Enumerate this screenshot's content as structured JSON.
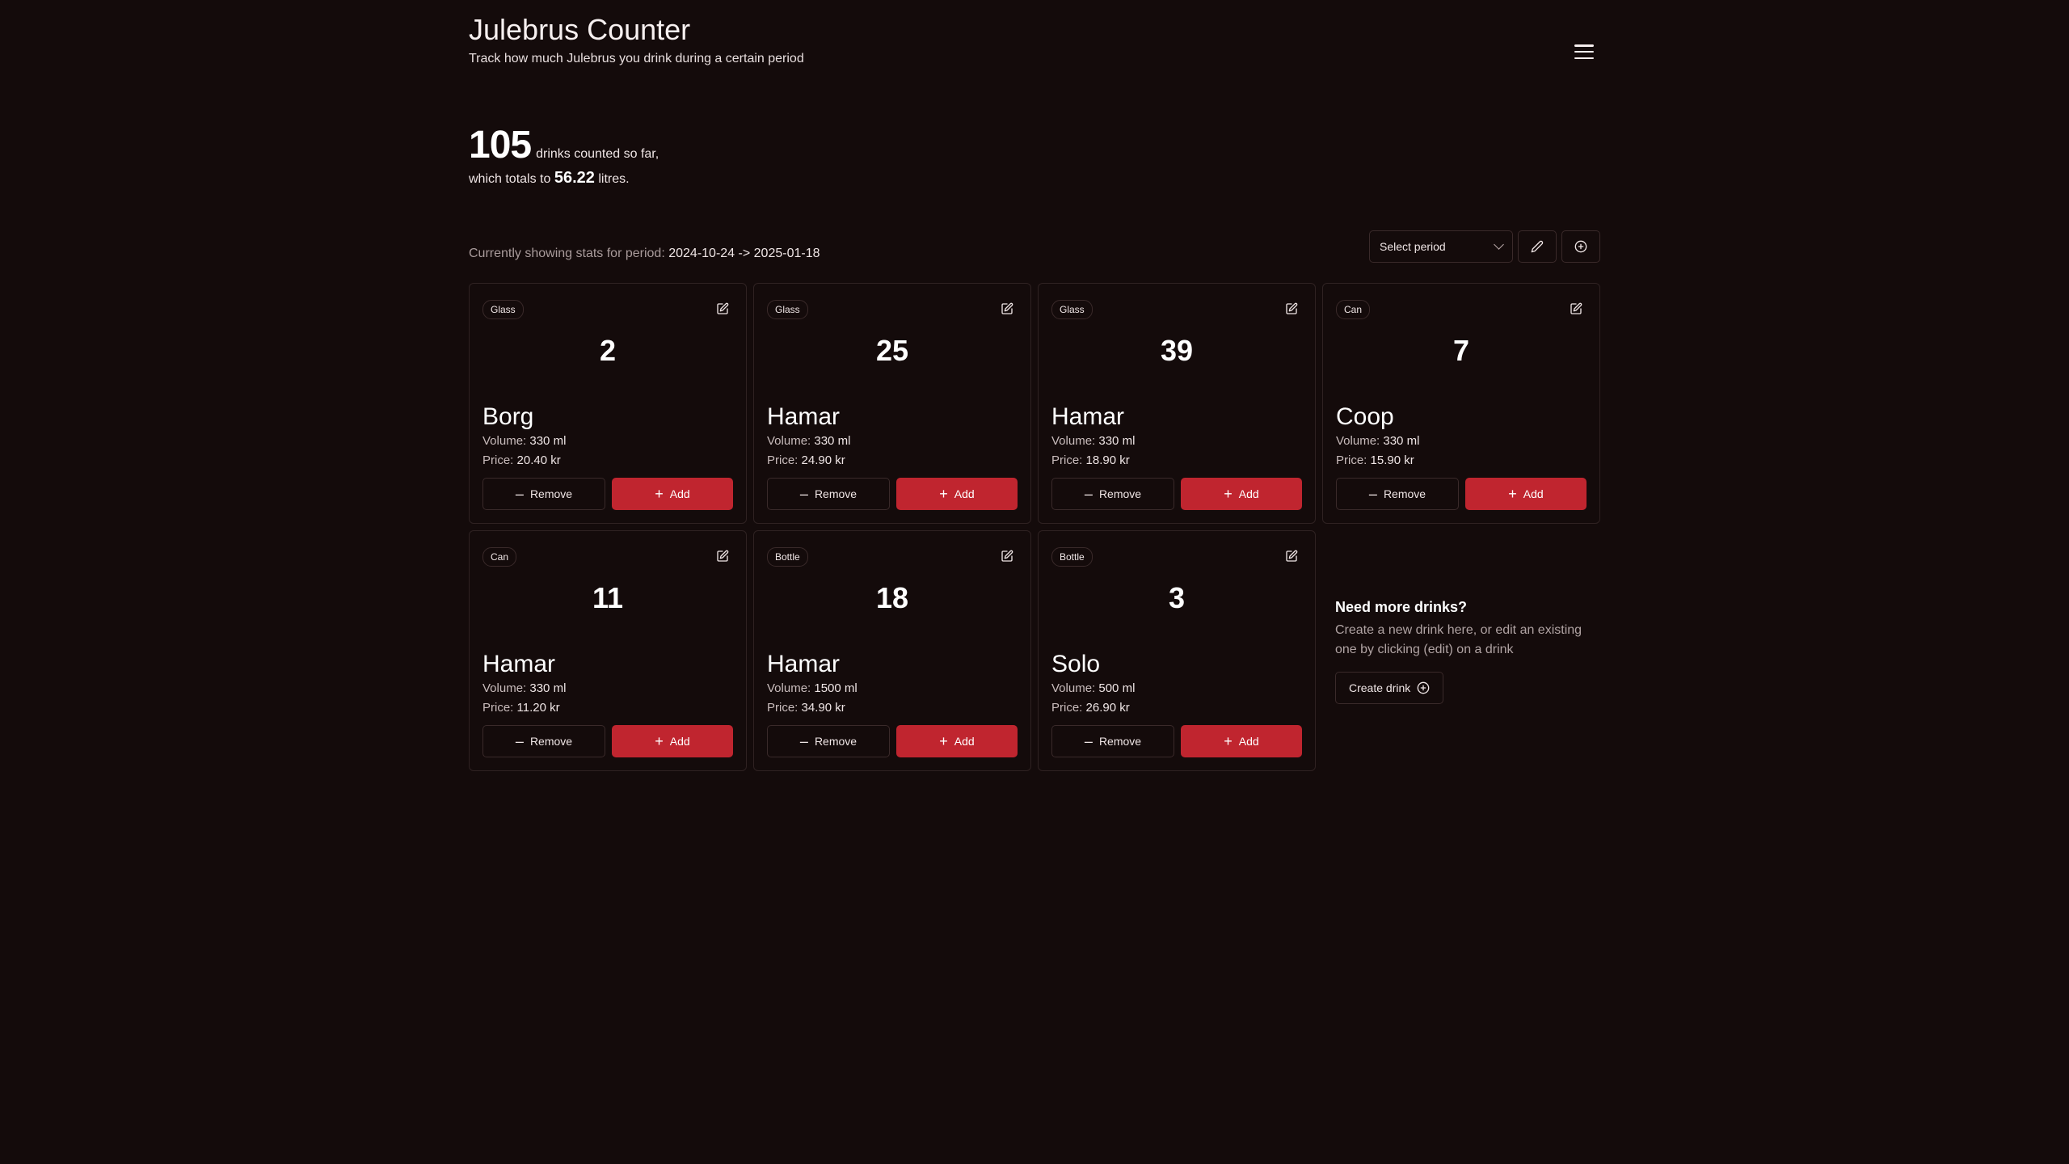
{
  "app": {
    "title": "Julebrus Counter",
    "subtitle": "Track how much Julebrus you drink during a certain period"
  },
  "stats": {
    "total_count": "105",
    "count_suffix": "drinks counted so far,",
    "litres_prefix": "which totals to",
    "litres": "56.22",
    "litres_suffix": "litres."
  },
  "period": {
    "label": "Currently showing stats for period:",
    "range": "2024-10-24 -> 2025-01-18",
    "select_placeholder": "Select period"
  },
  "labels": {
    "volume": "Volume:",
    "price": "Price:",
    "remove": "Remove",
    "add": "Add"
  },
  "drinks": [
    {
      "type": "Glass",
      "count": "2",
      "name": "Borg",
      "volume": "330 ml",
      "price": "20.40 kr"
    },
    {
      "type": "Glass",
      "count": "25",
      "name": "Hamar",
      "volume": "330 ml",
      "price": "24.90 kr"
    },
    {
      "type": "Glass",
      "count": "39",
      "name": "Hamar",
      "volume": "330 ml",
      "price": "18.90 kr"
    },
    {
      "type": "Can",
      "count": "7",
      "name": "Coop",
      "volume": "330 ml",
      "price": "15.90 kr"
    },
    {
      "type": "Can",
      "count": "11",
      "name": "Hamar",
      "volume": "330 ml",
      "price": "11.20 kr"
    },
    {
      "type": "Bottle",
      "count": "18",
      "name": "Hamar",
      "volume": "1500 ml",
      "price": "34.90 kr"
    },
    {
      "type": "Bottle",
      "count": "3",
      "name": "Solo",
      "volume": "500 ml",
      "price": "26.90 kr"
    }
  ],
  "more": {
    "title": "Need more drinks?",
    "text": "Create a new drink here, or edit an existing one by clicking (edit) on a drink",
    "button": "Create drink"
  },
  "colors": {
    "background": "#140b0b",
    "accent": "#c0252f"
  }
}
